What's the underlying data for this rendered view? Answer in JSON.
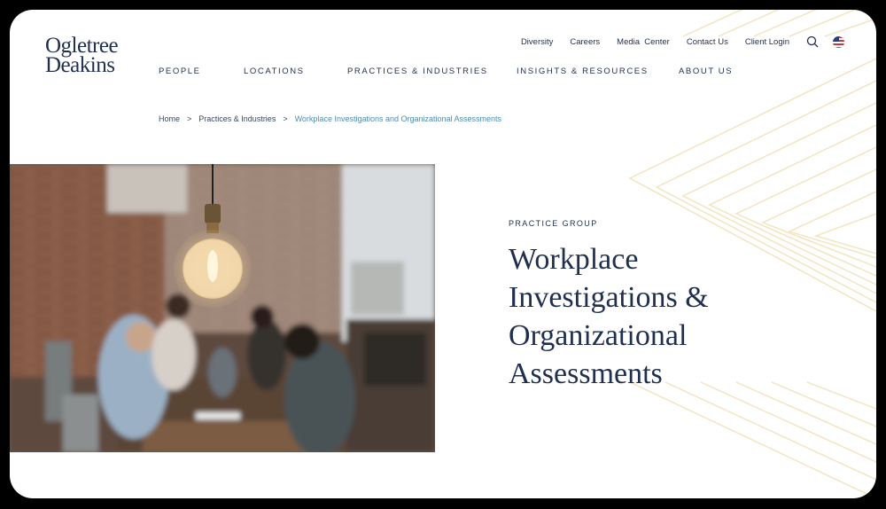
{
  "brand": {
    "line1": "Ogletree",
    "line2": "Deakins"
  },
  "utility_nav": {
    "diversity": "Diversity",
    "careers": "Careers",
    "media_center": "Media  Center",
    "contact_us": "Contact Us",
    "client_login": "Client Login"
  },
  "main_nav": {
    "people": "PEOPLE",
    "locations": "LOCATIONS",
    "practices": "PRACTICES & INDUSTRIES",
    "insights": "INSIGHTS & RESOURCES",
    "about": "ABOUT US"
  },
  "breadcrumb": {
    "home": "Home",
    "separator": ">",
    "practices": "Practices & Industries",
    "current": "Workplace Investigations and Organizational Assessments"
  },
  "hero": {
    "eyebrow": "PRACTICE GROUP",
    "title_line1": "Workplace",
    "title_line2": "Investigations &",
    "title_line3": "Organizational",
    "title_line4": "Assessments"
  },
  "icons": {
    "search": "search-icon",
    "flag": "us-flag-icon"
  },
  "colors": {
    "navy": "#1f2f4d",
    "breadcrumb_current": "#4d8bb0",
    "decor_gold": "#efd9a6"
  }
}
